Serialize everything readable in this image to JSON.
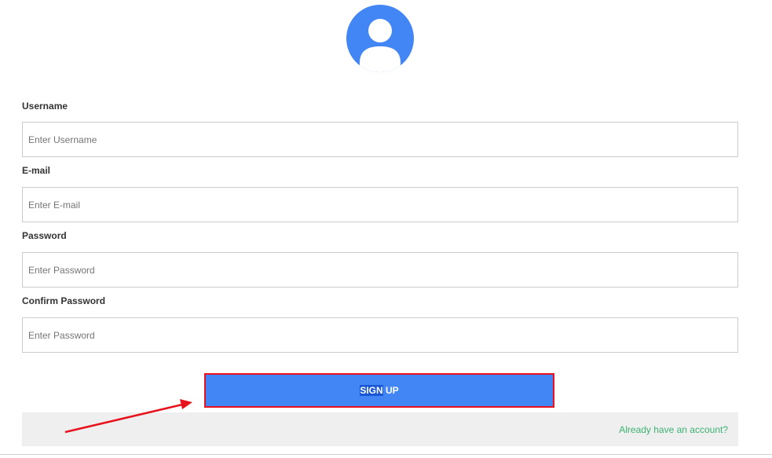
{
  "avatar": {
    "icon": "user-avatar-icon",
    "color": "#4285f4"
  },
  "form": {
    "username": {
      "label": "Username",
      "placeholder": "Enter Username"
    },
    "email": {
      "label": "E-mail",
      "placeholder": "Enter E-mail"
    },
    "password": {
      "label": "Password",
      "placeholder": "Enter Password"
    },
    "confirm_password": {
      "label": "Confirm Password",
      "placeholder": "Enter Password"
    }
  },
  "signup": {
    "label_selected": "SIGN",
    "label_rest": " UP",
    "color": "#4285f4",
    "highlight_color": "#e8121d"
  },
  "footer": {
    "login_link": "Already have an account?",
    "link_color": "#3cb371"
  },
  "annotation": {
    "arrow_color": "#e8121d"
  }
}
